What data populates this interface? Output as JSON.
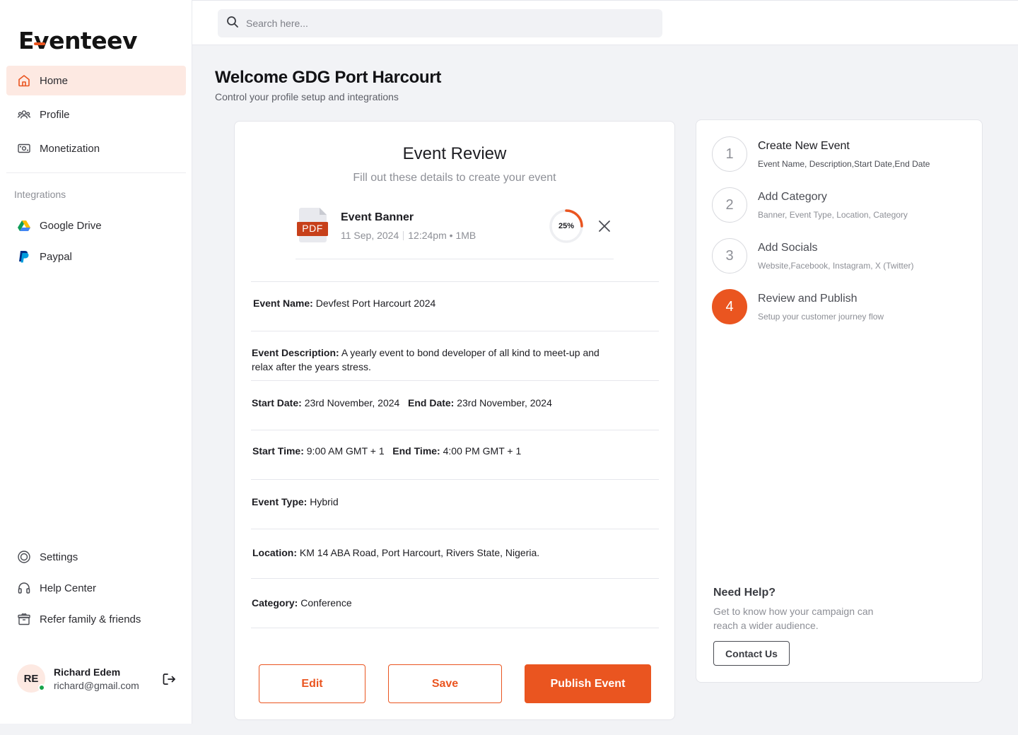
{
  "app": {
    "logo_prefix": "E",
    "logo_v": "v",
    "logo_suffix": "enteev",
    "accent": "#ea5520"
  },
  "sidebar": {
    "items": [
      {
        "label": "Home",
        "icon": "home-icon",
        "active": true
      },
      {
        "label": "Profile",
        "icon": "users-icon"
      },
      {
        "label": "Monetization",
        "icon": "money-icon"
      }
    ],
    "integrations_label": "Integrations",
    "integrations": [
      {
        "label": "Google Drive",
        "icon": "google-drive-icon"
      },
      {
        "label": "Paypal",
        "icon": "paypal-icon"
      }
    ],
    "bottom_items": [
      {
        "label": "Settings",
        "icon": "settings-icon"
      },
      {
        "label": "Help Center",
        "icon": "headset-icon"
      },
      {
        "label": "Refer family & friends",
        "icon": "gift-icon"
      }
    ],
    "user": {
      "initials": "RE",
      "name": "Richard Edem",
      "email": "richard@gmail.com",
      "status_color": "#16a34a"
    }
  },
  "search": {
    "placeholder": "Search here..."
  },
  "header": {
    "title": "Welcome GDG Port Harcourt",
    "subtitle": "Control your profile setup and integrations"
  },
  "review": {
    "title": "Event Review",
    "subtitle": "Fill out these details to create your event",
    "file": {
      "name": "Event Banner",
      "type": "PDF",
      "date": "11 Sep, 2024",
      "time": "12:24pm",
      "size": "1MB",
      "progress_percent": 25,
      "progress_label": "25%"
    },
    "fields": {
      "event_name_label": "Event Name:",
      "event_name": "Devfest Port Harcourt 2024",
      "description_label": "Event Description:",
      "description": "A yearly event to bond developer of all kind to meet-up and relax after the years stress.",
      "start_date_label": "Start Date:",
      "start_date": "23rd November, 2024",
      "end_date_label": "End Date:",
      "end_date": "23rd November, 2024",
      "start_time_label": "Start Time:",
      "start_time": "9:00 AM GMT + 1",
      "end_time_label": "End Time:",
      "end_time": "4:00 PM GMT + 1",
      "event_type_label": "Event Type:",
      "event_type": "Hybrid",
      "location_label": "Location:",
      "location": "KM 14 ABA Road, Port Harcourt, Rivers State, Nigeria.",
      "category_label": "Category:",
      "category": "Conference"
    },
    "buttons": {
      "edit": "Edit",
      "save": "Save",
      "publish": "Publish Event"
    }
  },
  "steps": [
    {
      "number": "1",
      "title": "Create New Event",
      "desc": "Event Name, Description,Start Date,End Date"
    },
    {
      "number": "2",
      "title": "Add Category",
      "desc": "Banner, Event Type, Location, Category"
    },
    {
      "number": "3",
      "title": "Add Socials",
      "desc": "Website,Facebook, Instagram, X (Twitter)"
    },
    {
      "number": "4",
      "title": "Review and Publish",
      "desc": "Setup your customer journey flow",
      "active": true
    }
  ],
  "help": {
    "title": "Need Help?",
    "text": "Get to know how your campaign can reach a wider audience.",
    "button": "Contact Us"
  }
}
